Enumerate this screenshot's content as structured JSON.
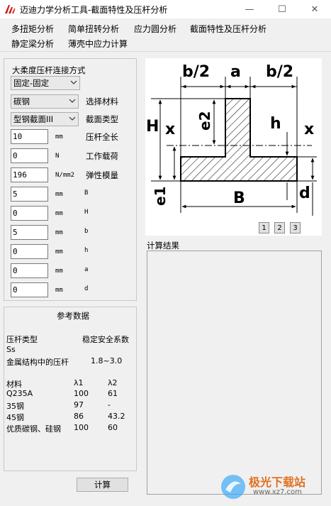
{
  "window": {
    "title": "迈迪力学分析工具-截面特性及压杆分析",
    "minimize": "—",
    "maximize": "☐",
    "close": "✕"
  },
  "menu": [
    "多扭矩分析",
    "简单扭转分析",
    "应力圆分析",
    "截面特性及压杆分析",
    "静定梁分析",
    "薄壳中应力计算"
  ],
  "params": {
    "connection_label": "大柔度压杆连接方式",
    "connection_value": "固定-固定",
    "material_value": "碳钢",
    "material_label": "选择材料",
    "section_value": "型钢截面III",
    "section_label": "截面类型",
    "fields": [
      {
        "value": "10",
        "unit": "mm",
        "label": "压杆全长"
      },
      {
        "value": "0",
        "unit": "N",
        "label": "工作载荷"
      },
      {
        "value": "196",
        "unit": "N/mm2",
        "label": "弹性模量"
      },
      {
        "value": "5",
        "unit": "mm",
        "label": "B"
      },
      {
        "value": "0",
        "unit": "mm",
        "label": "H"
      },
      {
        "value": "5",
        "unit": "mm",
        "label": "b"
      },
      {
        "value": "0",
        "unit": "mm",
        "label": "h"
      },
      {
        "value": "0",
        "unit": "mm",
        "label": "a"
      },
      {
        "value": "0",
        "unit": "mm",
        "label": "d"
      }
    ]
  },
  "reference": {
    "title": "参考数据",
    "bar_type": "压杆类型",
    "safety_factor": "稳定安全系数",
    "ss": "Ss",
    "metal_struct": "金属结构中的压杆",
    "metal_range": "1.8~3.0",
    "table_header": [
      "材料",
      "λ1",
      "λ2"
    ],
    "rows": [
      [
        "Q235A",
        "100",
        "61"
      ],
      [
        "35钢",
        "97",
        "-"
      ],
      [
        "45钢",
        "86",
        "43.2"
      ],
      [
        "优质碳钢、硅钢",
        "100",
        "60"
      ]
    ]
  },
  "diagram": {
    "labels": {
      "b_half_left": "b/2",
      "a": "a",
      "b_half_right": "b/2",
      "H": "H",
      "x_left": "x",
      "e2": "e2",
      "h": "h",
      "x_right": "x",
      "e1": "e1",
      "B": "B",
      "d": "d"
    },
    "pages": [
      "1",
      "2",
      "3"
    ]
  },
  "result": {
    "title": "计算结果"
  },
  "compute_button": "计算",
  "watermark": {
    "brand": "极光下载站",
    "url": "www.xz7.com"
  }
}
